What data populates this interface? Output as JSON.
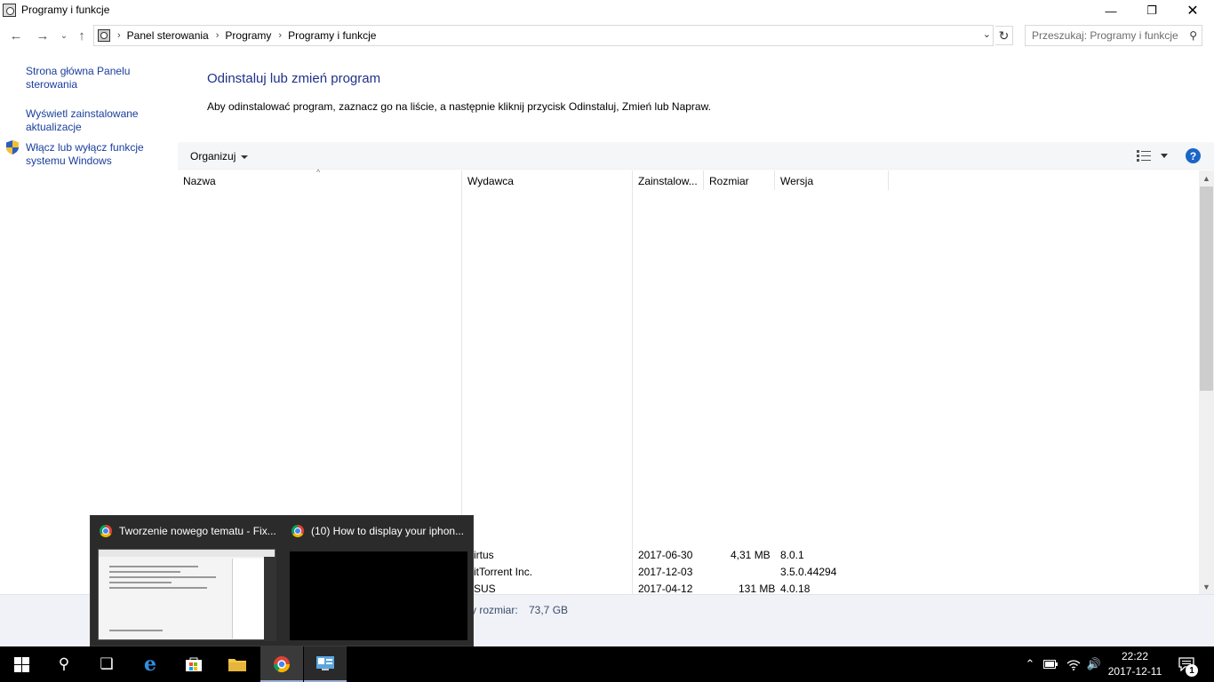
{
  "window": {
    "title": "Programy i funkcje",
    "minimize": "—",
    "maximize": "❐",
    "close": "✕"
  },
  "address": {
    "breadcrumbs": [
      "Panel sterowania",
      "Programy",
      "Programy i funkcje"
    ],
    "search_placeholder": "Przeszukaj: Programy i funkcje"
  },
  "sidebar": {
    "items": [
      {
        "label": "Strona główna Panelu sterowania"
      },
      {
        "label": "Wyświetl zainstalowane aktualizacje"
      },
      {
        "label": "Włącz lub wyłącz funkcje systemu Windows"
      }
    ]
  },
  "main": {
    "heading": "Odinstaluj lub zmień program",
    "description": "Aby odinstalować program, zaznacz go na liście, a następnie kliknij przycisk Odinstaluj, Zmień lub Napraw.",
    "organize_label": "Organizuj",
    "help": "?",
    "columns": [
      "Nazwa",
      "Wydawca",
      "Zainstalow...",
      "Rozmiar",
      "Wersja"
    ],
    "rows": [
      {
        "publisher": "irtus",
        "installed": "2017-06-30",
        "size": "4,31 MB",
        "version": "8.0.1"
      },
      {
        "publisher": "itTorrent Inc.",
        "installed": "2017-12-03",
        "size": "",
        "version": "3.5.0.44294"
      },
      {
        "publisher": "SUS",
        "installed": "2017-04-12",
        "size": "131 MB",
        "version": "4.0.18"
      }
    ],
    "status_total": "y rozmiar:",
    "status_size": "73,7 GB"
  },
  "thumbnails": [
    {
      "title": "Tworzenie nowego tematu - Fix..."
    },
    {
      "title": "(10) How to display your iphon..."
    }
  ],
  "taskbar": {
    "time": "22:22",
    "date": "2017-12-11",
    "notifications": "1"
  }
}
